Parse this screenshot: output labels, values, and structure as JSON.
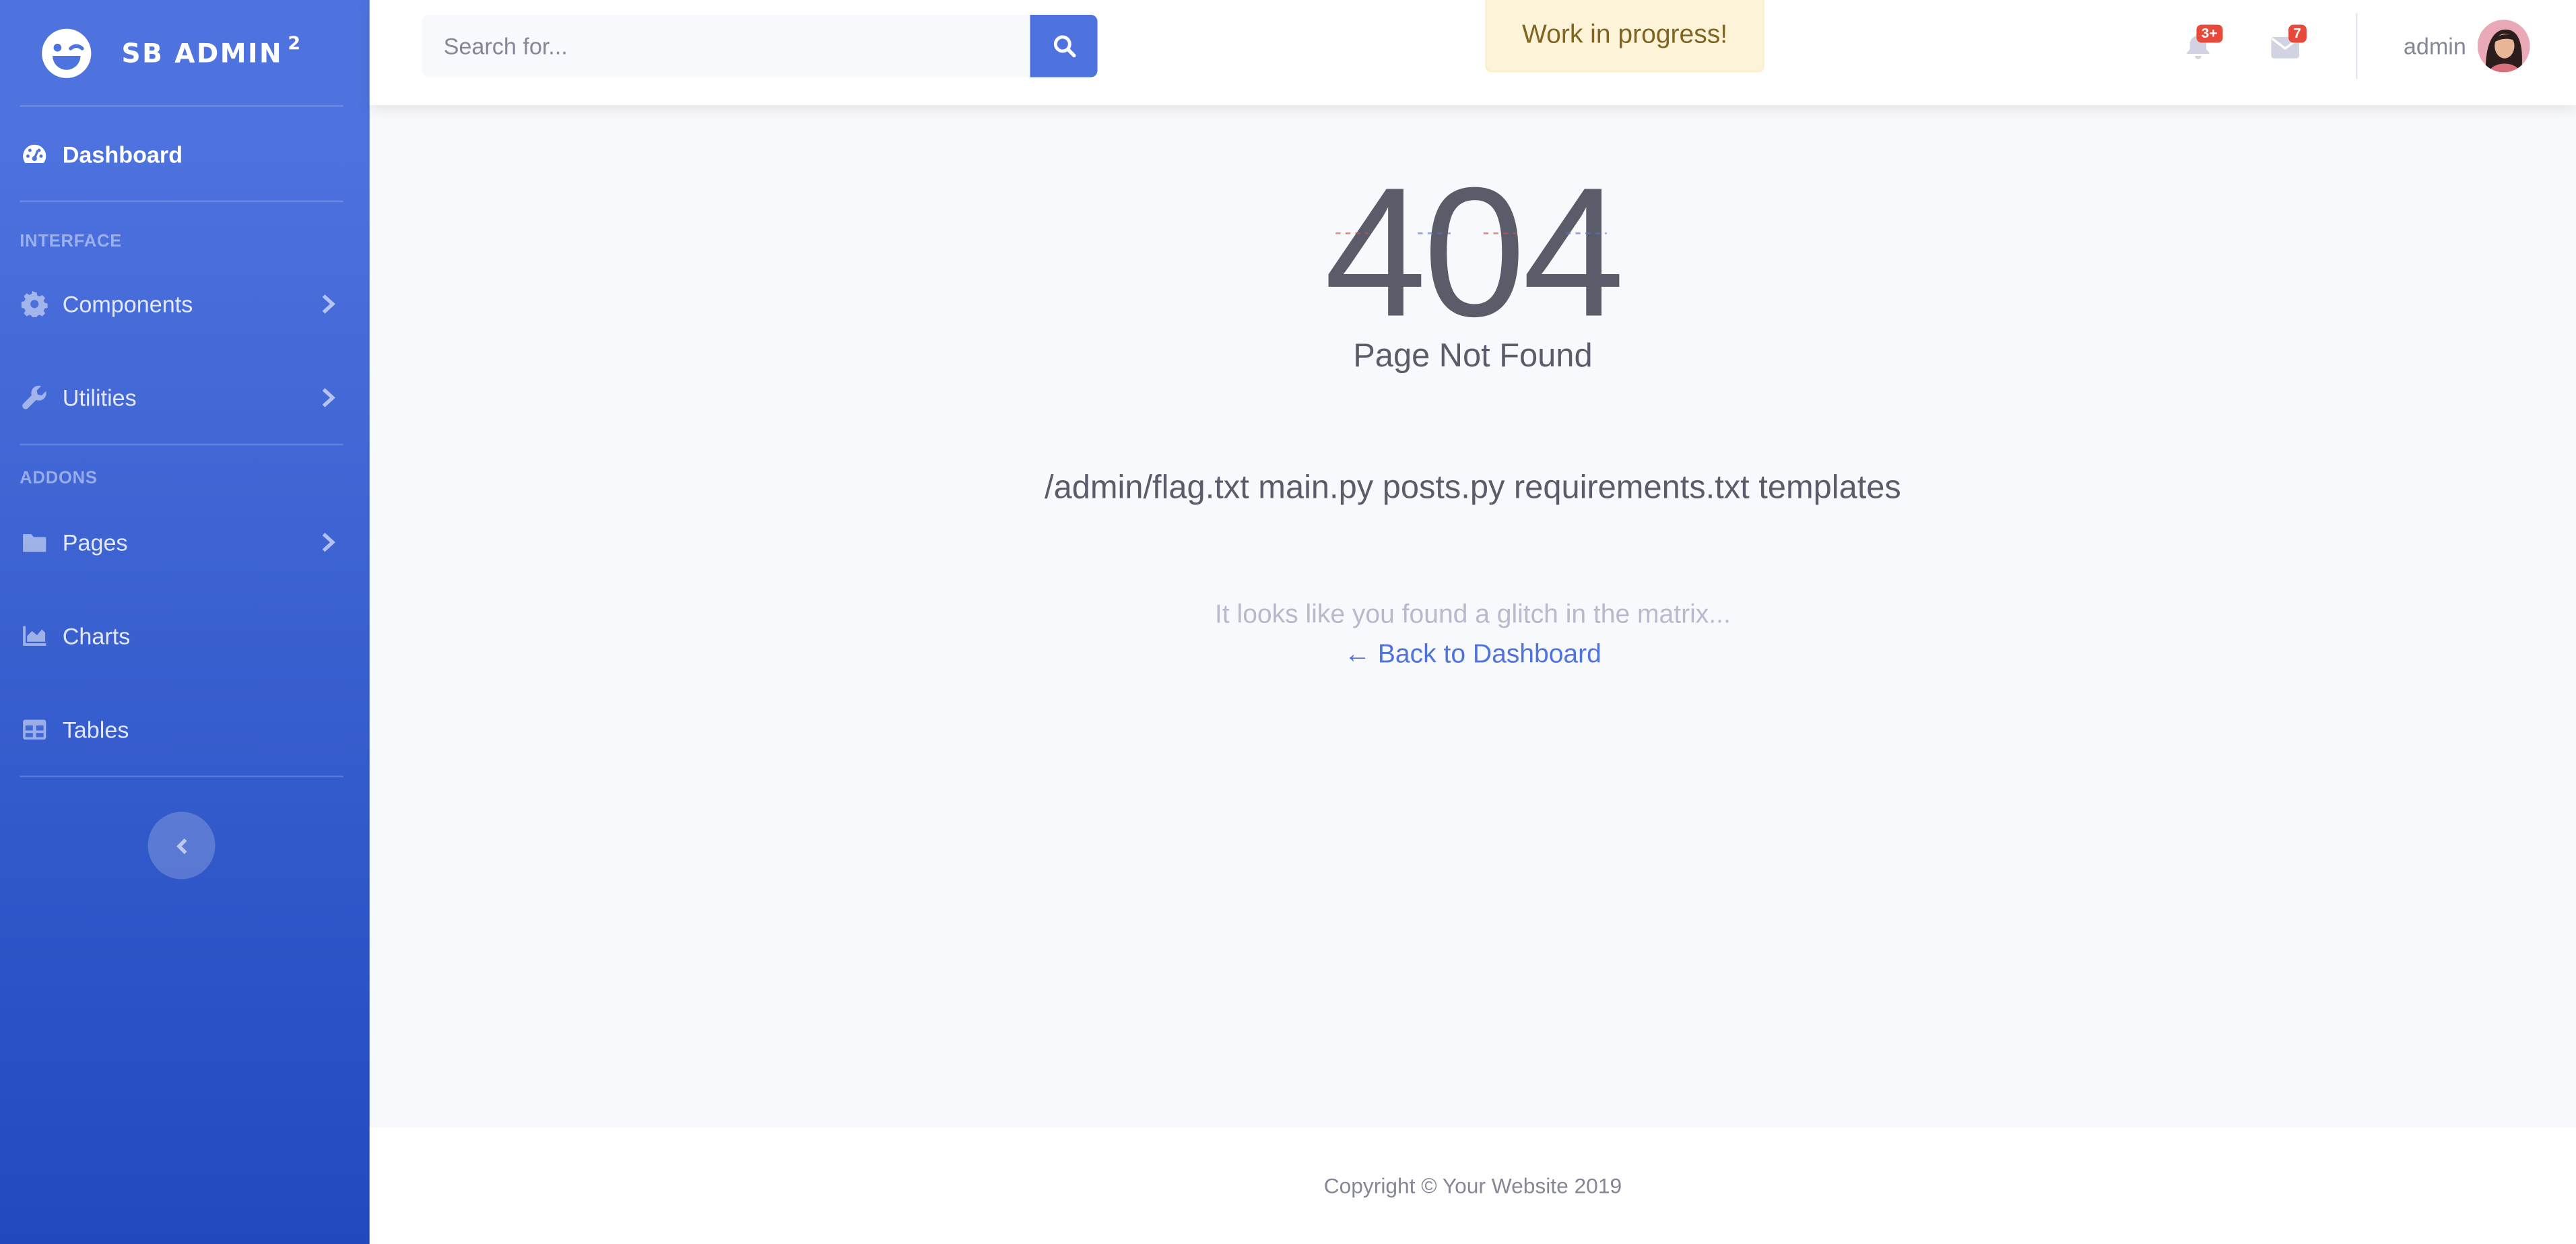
{
  "sidebar": {
    "brand": {
      "title": "SB ADMIN",
      "superscript": "2",
      "icon": "laugh-wink-icon"
    },
    "items": [
      {
        "label": "Dashboard",
        "icon": "tachometer-icon",
        "active": true
      },
      {
        "heading": "INTERFACE"
      },
      {
        "label": "Components",
        "icon": "cog-icon",
        "has_submenu": true
      },
      {
        "label": "Utilities",
        "icon": "wrench-icon",
        "has_submenu": true
      },
      {
        "heading": "ADDONS"
      },
      {
        "label": "Pages",
        "icon": "folder-icon",
        "has_submenu": true
      },
      {
        "label": "Charts",
        "icon": "chart-area-icon"
      },
      {
        "label": "Tables",
        "icon": "table-icon"
      }
    ],
    "toggle_icon": "angle-left-icon"
  },
  "topbar": {
    "search": {
      "placeholder": "Search for...",
      "value": ""
    },
    "alert": "Work in progress!",
    "alerts_badge": "3+",
    "messages_badge": "7",
    "user_name": "admin"
  },
  "main": {
    "error_code": "404",
    "title": "Page Not Found",
    "listing": "/admin/flag.txt main.py posts.py requirements.txt templates",
    "message": "It looks like you found a glitch in the matrix...",
    "back_link": "← Back to Dashboard"
  },
  "footer": {
    "copyright": "Copyright © Your Website 2019"
  },
  "colors": {
    "primary": "#4e73df",
    "primary_dark": "#224abe",
    "danger": "#e74a3b",
    "warning_bg": "#fdf3d8",
    "text_gray": "#5a5c69"
  }
}
